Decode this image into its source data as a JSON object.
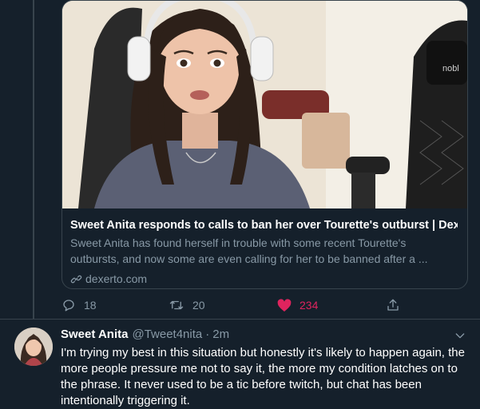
{
  "link_card": {
    "title": "Sweet Anita responds to calls to ban her over Tourette's outburst | Dexe...",
    "description": "Sweet Anita has found herself in trouble with some recent Tourette's outbursts, and now some are even calling for her to be banned after a ...",
    "domain": "dexerto.com",
    "chair_brand": "nobl"
  },
  "actions": {
    "reply_count": "18",
    "retweet_count": "20",
    "like_count": "234",
    "liked": true
  },
  "reply_tweet": {
    "name": "Sweet Anita",
    "handle": "@Tweet4nita",
    "separator": "·",
    "time": "2m",
    "text": "I'm trying my best in this situation but honestly it's likely to happen again, the more people pressure me not to say it, the more my condition latches on to the phrase. It never used to be a tic before twitch, but chat has been intentionally triggering it."
  },
  "colors": {
    "background": "#15202b",
    "border": "#38444d",
    "secondary_text": "#8899a6",
    "like": "#e0245e"
  }
}
